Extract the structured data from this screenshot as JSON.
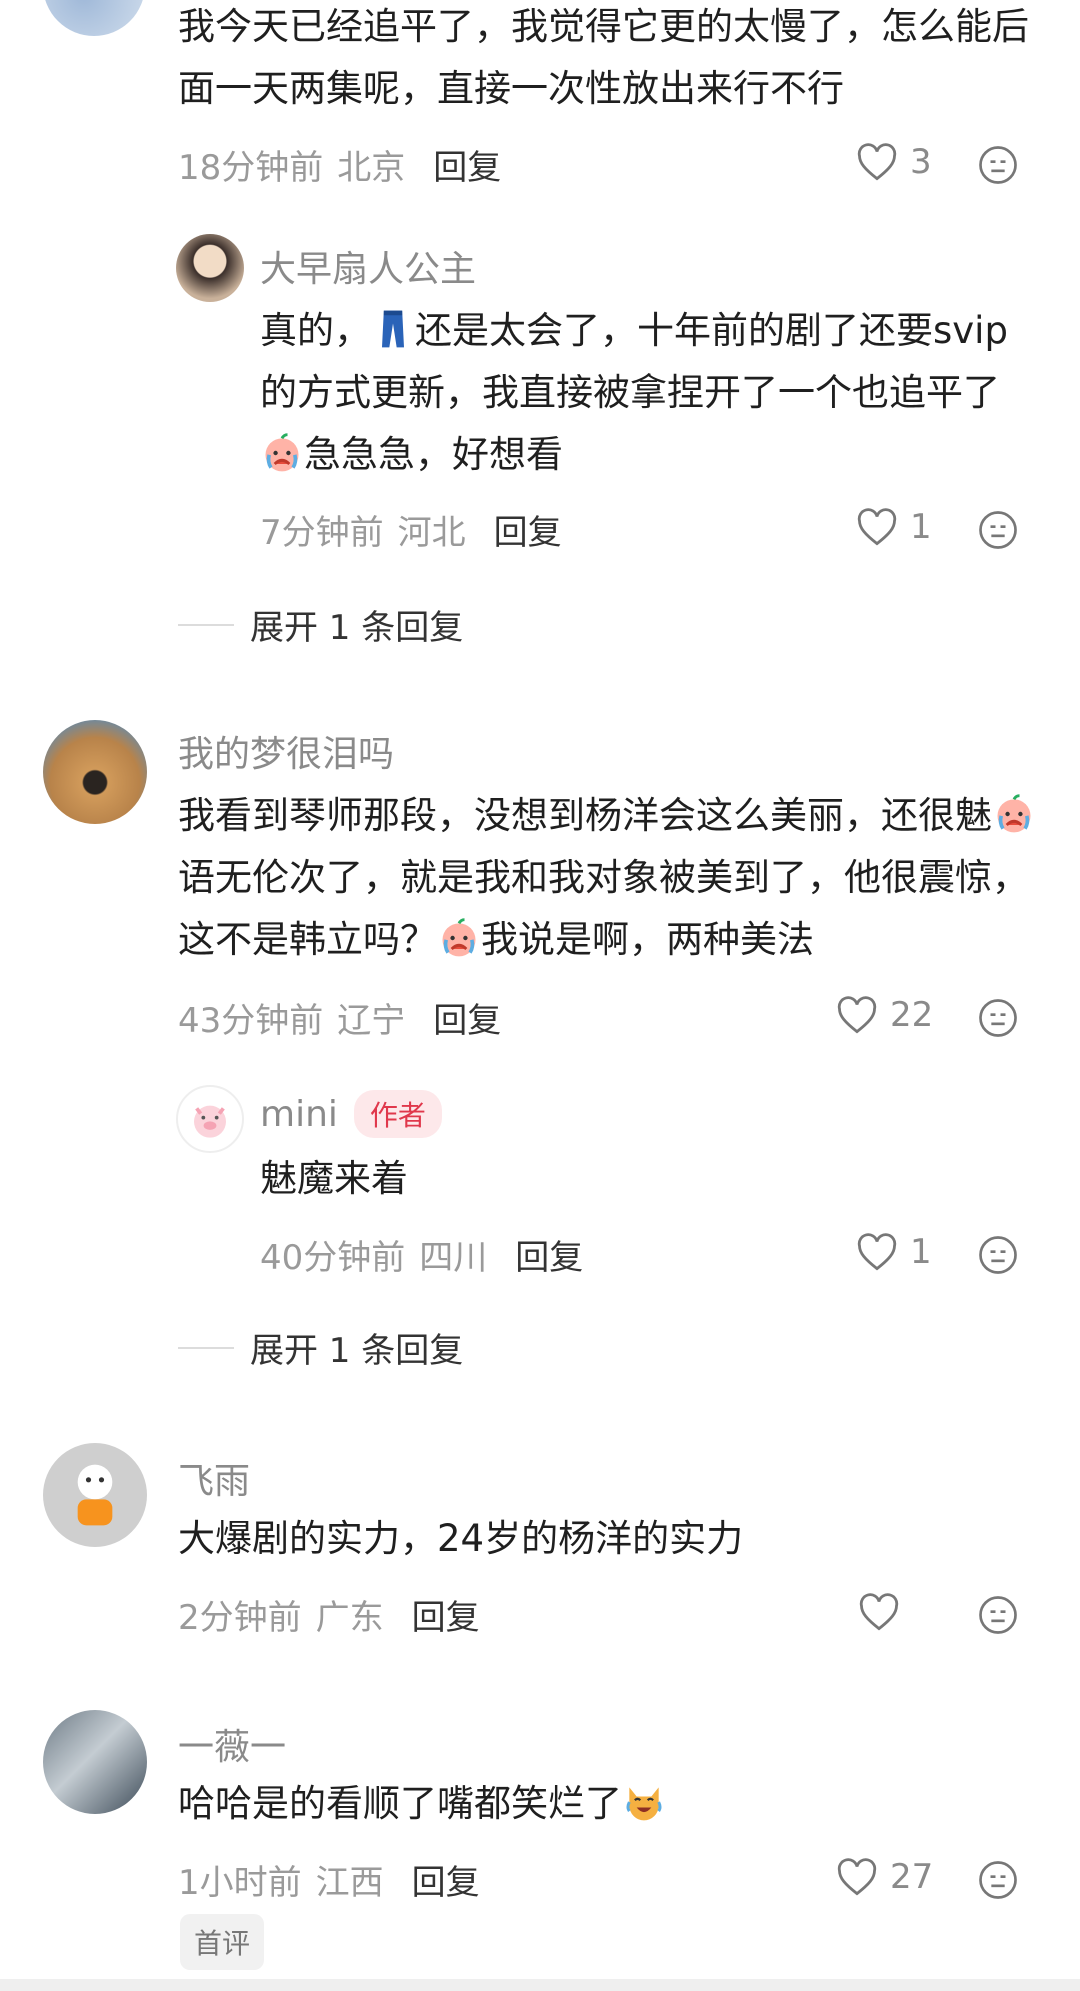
{
  "comments": [
    {
      "text": "我今天已经追平了，我觉得它更的太慢了，怎么能后面一天两集呢，直接一次性放出来行不行",
      "time": "18分钟前",
      "location": "北京",
      "reply_label": "回复",
      "likes": "3",
      "replies": [
        {
          "user": "大早扇人公主",
          "text_parts": [
            "真的，",
            "还是太会了，十年前的剧了还要svip的方式更新，我直接被拿捏开了一个也追平了",
            "急急急，好想看"
          ],
          "time": "7分钟前",
          "location": "河北",
          "reply_label": "回复",
          "likes": "1"
        }
      ],
      "expand_label": "展开 1 条回复"
    },
    {
      "user": "我的梦很泪吗",
      "text_parts": [
        "我看到琴师那段，没想到杨洋会这么美丽，还很魅",
        "语无伦次了，就是我和我对象被美到了，他很震惊，这不是韩立吗？",
        "我说是啊，两种美法"
      ],
      "time": "43分钟前",
      "location": "辽宁",
      "reply_label": "回复",
      "likes": "22",
      "replies": [
        {
          "user": "mini",
          "badge": "作者",
          "text": "魅魔来着",
          "time": "40分钟前",
          "location": "四川",
          "reply_label": "回复",
          "likes": "1"
        }
      ],
      "expand_label": "展开 1 条回复"
    },
    {
      "user": "飞雨",
      "text": "大爆剧的实力，24岁的杨洋的实力",
      "time": "2分钟前",
      "location": "广东",
      "reply_label": "回复",
      "likes": ""
    },
    {
      "user": "一薇一",
      "text": "哈哈是的看顺了嘴都笑烂了",
      "time": "1小时前",
      "location": "江西",
      "reply_label": "回复",
      "likes": "27",
      "tag": "首评"
    }
  ],
  "icons": {
    "like": "heart-outline-icon",
    "dislike": "meh-face-icon",
    "crying_emoji": "crying-emoji-icon",
    "jeans_emoji": "jeans-emoji-icon",
    "laughing_cat_emoji": "laughing-cat-emoji-icon"
  },
  "colors": {
    "author_badge_bg": "#fde8ea",
    "author_badge_text": "#e0384c"
  }
}
